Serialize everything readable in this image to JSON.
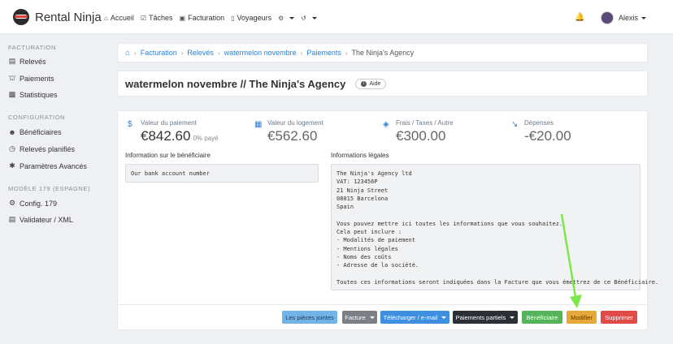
{
  "brand": {
    "name": "Rental Ninja"
  },
  "nav": {
    "items": [
      {
        "icon": "home-icon",
        "glyph": "⌂",
        "label": "Accueil"
      },
      {
        "icon": "check-icon",
        "glyph": "☑",
        "label": "Tâches"
      },
      {
        "icon": "invoice-icon",
        "glyph": "▣",
        "label": "Facturation"
      },
      {
        "icon": "travelers-icon",
        "glyph": "▯",
        "label": "Voyageurs"
      }
    ],
    "user_name": "Alexis"
  },
  "sidebar": {
    "sections": [
      {
        "heading": "FACTURATION",
        "items": [
          "Relevés",
          "Paiements",
          "Statistiques"
        ]
      },
      {
        "heading": "CONFIGURATION",
        "items": [
          "Bénéficiaires",
          "Relevés planifiés",
          "Paramètres Avancés"
        ]
      },
      {
        "heading": "MODÈLE 179 (ESPAGNE)",
        "items": [
          "Config. 179",
          "Validateur / XML"
        ]
      }
    ]
  },
  "breadcrumb": {
    "items": [
      "Facturation",
      "Relevés",
      "watermelon novembre",
      "Paiements"
    ],
    "current": "The Ninja's Agency"
  },
  "page": {
    "title": "watermelon novembre // The Ninja's Agency",
    "help_label": "Aide"
  },
  "stats": [
    {
      "label": "Valeur du paiement",
      "value": "€842.60",
      "sub": "0% payé"
    },
    {
      "label": "Valeur du logement",
      "value": "€562.60"
    },
    {
      "label": "Frais / Taxes / Autre",
      "value": "€300.00"
    },
    {
      "label": "Dépenses",
      "value": "-€20.00"
    }
  ],
  "beneficiary": {
    "label": "Information sur le bénéficiaire",
    "text": "Our bank account number"
  },
  "legal": {
    "label": "Informations légales",
    "text": "The Ninja's Agency ltd\nVAT: 123456P\n21 Ninja Street\n08015 Barcelona\nSpain\n\nVous pouvez mettre ici toutes les informations que vous souhaitez.\nCela peut inclure :\n- Modalités de paiement\n- Mentions légales\n- Noms des coûts\n- Adresse de la société.\n\nToutes ces informations seront indiquées dans la Facture que vous émettrez de ce Bénéficiaire."
  },
  "actions": {
    "attachments": "Les pièces jointes",
    "invoice": "Facture",
    "download": "Télécharger / e-mail",
    "partial_payments": "Paiements partiels",
    "beneficiaries": "Bénéficiaire",
    "edit": "Modifier",
    "delete": "Supprimer"
  },
  "colors": {
    "link": "#2a7fd4",
    "highlight_arrow": "#7ee84a",
    "edit_button": "#e6a83a",
    "delete_button": "#e04b47"
  }
}
